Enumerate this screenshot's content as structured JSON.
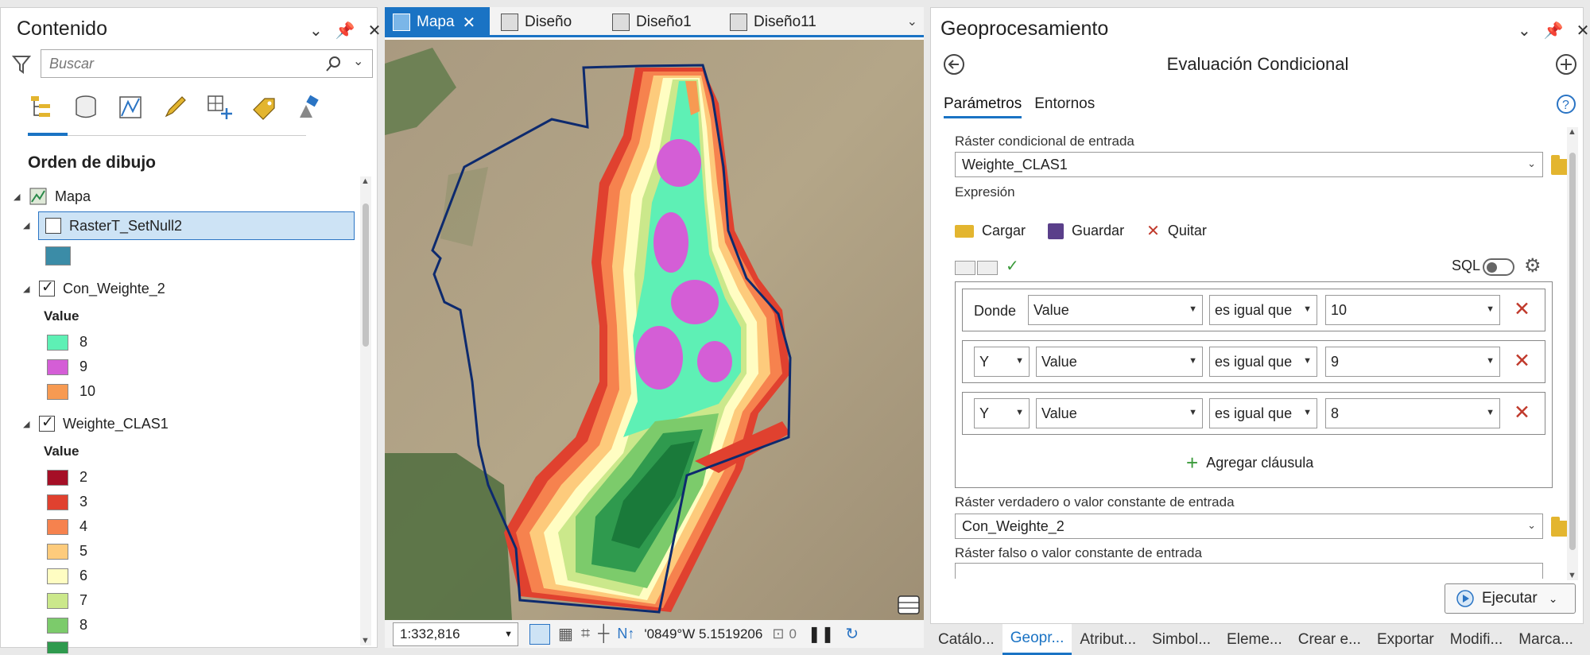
{
  "left_pane": {
    "title": "Contenido",
    "search_placeholder": "Buscar",
    "section_title": "Orden de dibujo",
    "map_name": "Mapa",
    "layers": [
      {
        "name": "RasterT_SetNull2",
        "checked": false,
        "selected": true,
        "swatch": "#3b8ca7"
      },
      {
        "name": "Con_Weighte_2",
        "checked": true,
        "legend_title": "Value",
        "classes": [
          {
            "label": "8",
            "color": "#5ef0b5"
          },
          {
            "label": "9",
            "color": "#d45ed6"
          },
          {
            "label": "10",
            "color": "#f79a52"
          }
        ]
      },
      {
        "name": "Weighte_CLAS1",
        "checked": true,
        "legend_title": "Value",
        "classes": [
          {
            "label": "2",
            "color": "#a50f26"
          },
          {
            "label": "3",
            "color": "#e0412f"
          },
          {
            "label": "4",
            "color": "#f6824e"
          },
          {
            "label": "5",
            "color": "#fdcb7c"
          },
          {
            "label": "6",
            "color": "#fffdc2"
          },
          {
            "label": "7",
            "color": "#cbe88b"
          },
          {
            "label": "8",
            "color": "#7ccb6b"
          }
        ]
      }
    ]
  },
  "map_pane": {
    "tabs": [
      {
        "label": "Mapa",
        "active": true
      },
      {
        "label": "Diseño",
        "active": false
      },
      {
        "label": "Diseño1",
        "active": false
      },
      {
        "label": "Diseño11",
        "active": false
      }
    ],
    "scale": "1:332,816",
    "coordinates": "'0849°W 5.1519206",
    "selected_count": "0"
  },
  "right_pane": {
    "title": "Geoprocesamiento",
    "tool_title": "Evaluación Condicional",
    "tabs": [
      {
        "label": "Parámetros",
        "active": true
      },
      {
        "label": "Entornos",
        "active": false
      }
    ],
    "input_raster_label": "Ráster condicional de entrada",
    "input_raster_value": "Weighte_CLAS1",
    "expression_label": "Expresión",
    "buttons": {
      "load": "Cargar",
      "save": "Guardar",
      "remove": "Quitar"
    },
    "sql_label": "SQL",
    "clauses": [
      {
        "connector": "Donde",
        "field": "Value",
        "operator": "es igual que",
        "value": "10"
      },
      {
        "connector": "Y",
        "field": "Value",
        "operator": "es igual que",
        "value": "9"
      },
      {
        "connector": "Y",
        "field": "Value",
        "operator": "es igual que",
        "value": "8"
      }
    ],
    "add_clause": "Agregar cláusula",
    "true_raster_label": "Ráster verdadero o valor constante de entrada",
    "true_raster_value": "Con_Weighte_2",
    "false_raster_label": "Ráster falso o valor constante de entrada",
    "run_label": "Ejecutar"
  },
  "bottom_tabs": [
    {
      "label": "Catálo...",
      "active": false
    },
    {
      "label": "Geopr...",
      "active": true
    },
    {
      "label": "Atribut...",
      "active": false
    },
    {
      "label": "Simbol...",
      "active": false
    },
    {
      "label": "Eleme...",
      "active": false
    },
    {
      "label": "Crear e...",
      "active": false
    },
    {
      "label": "Exportar",
      "active": false
    },
    {
      "label": "Modifi...",
      "active": false
    },
    {
      "label": "Marca...",
      "active": false
    }
  ]
}
